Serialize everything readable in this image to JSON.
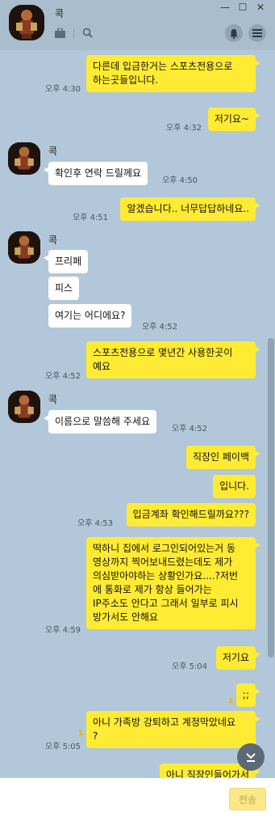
{
  "header": {
    "title": "콕",
    "win_minimize": "—",
    "win_maximize": "☐",
    "win_close": "✕"
  },
  "messages": {
    "m1": {
      "text": "다른데 입금한거는 스포츠전용으로\n하는곳들입니다.",
      "time": "오후 4:30"
    },
    "m2": {
      "text": "저기요~",
      "time": "오후 4:32"
    },
    "m3": {
      "name": "콕",
      "text": "확인후 연락 드릴께요",
      "time": "오후 4:50"
    },
    "m4": {
      "text": "알겠습니다.. 너무답답하네요..",
      "time": "오후 4:51"
    },
    "m5": {
      "name": "콕",
      "text": "프리페"
    },
    "m6": {
      "text": "피스"
    },
    "m7": {
      "text": "여기는 어디에요?",
      "time": "오후 4:52"
    },
    "m8": {
      "text": "스포츠전용으로 몇년간 사용한곳이\n예요",
      "time": "오후 4:52"
    },
    "m9": {
      "name": "콕",
      "text": "이름으로 말씀해 주세요",
      "time": "오후 4:52"
    },
    "m10": {
      "text": "직장인 페이백"
    },
    "m11": {
      "text": "입니다."
    },
    "m12": {
      "text": "입금계좌 확인해드릴까요???",
      "time": "오후 4:53"
    },
    "m13": {
      "text": "떡하니 집에서 로그인되어있는거 동\n영상까지 찍어보내드렸는데도 제가\n의심받아야하는 상황인가요....?저번\n에 통화로 제가 항상 들어가는\nIP주소도 안다고 그래서 일부로 피시\n방가서도 안해요",
      "time": "오후 4:59"
    },
    "m14": {
      "text": "저기요",
      "time": "오후 5:04"
    },
    "m15": {
      "text": ";;",
      "unread": "1"
    },
    "m16": {
      "text": "아니 가족방 강퇴하고 계정막았네요\n?",
      "time": "오후 5:05",
      "unread": "1"
    },
    "m17": {
      "text": "아니 직장인들어가서"
    }
  },
  "composer": {
    "placeholder": "",
    "send_label": "전송"
  },
  "icons": {
    "folder": "folder-icon",
    "search": "search-icon",
    "bell": "bell-icon",
    "menu": "menu-icon",
    "scroll_down": "chevron-down-icon"
  }
}
